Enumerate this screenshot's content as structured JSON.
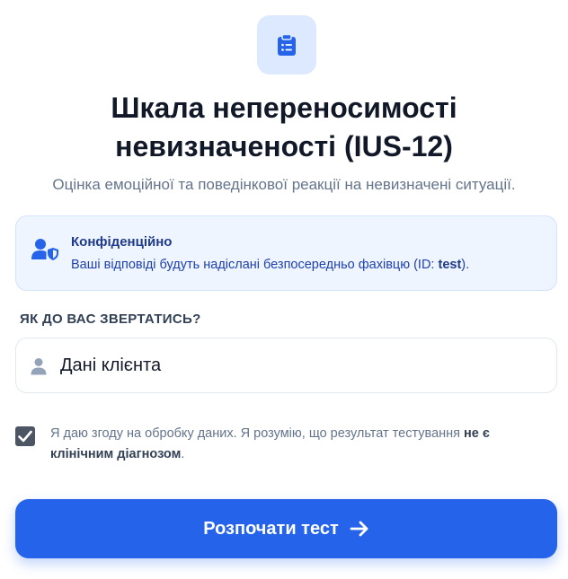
{
  "header": {
    "icon": "clipboard-list-icon",
    "title_line1": "Шкала непереносимості",
    "title_line2": "невизначеності (IUS-12)",
    "subtitle": "Оцінка емоційної та поведінкової реакції на невизначені ситуації."
  },
  "notice": {
    "icon": "user-shield-icon",
    "title": "Конфіденційно",
    "text_before": "Ваші відповіді будуть надіслані безпосередньо фахівцю (ID: ",
    "id_value": "test",
    "text_after": ")."
  },
  "name_field": {
    "label": "ЯК ДО ВАС ЗВЕРТАТИСЬ?",
    "icon": "user-icon",
    "value": "Дані клієнта"
  },
  "consent": {
    "checked": true,
    "text": "Я даю згоду на обробку даних. Я розумію, що результат тестування ",
    "bold_text": "не є клінічним діагнозом",
    "text_end": "."
  },
  "start_button": {
    "label": "Розпочати тест",
    "icon": "arrow-right-icon"
  },
  "colors": {
    "accent": "#2563eb",
    "notice_bg": "#eff5ff",
    "title": "#111827"
  }
}
